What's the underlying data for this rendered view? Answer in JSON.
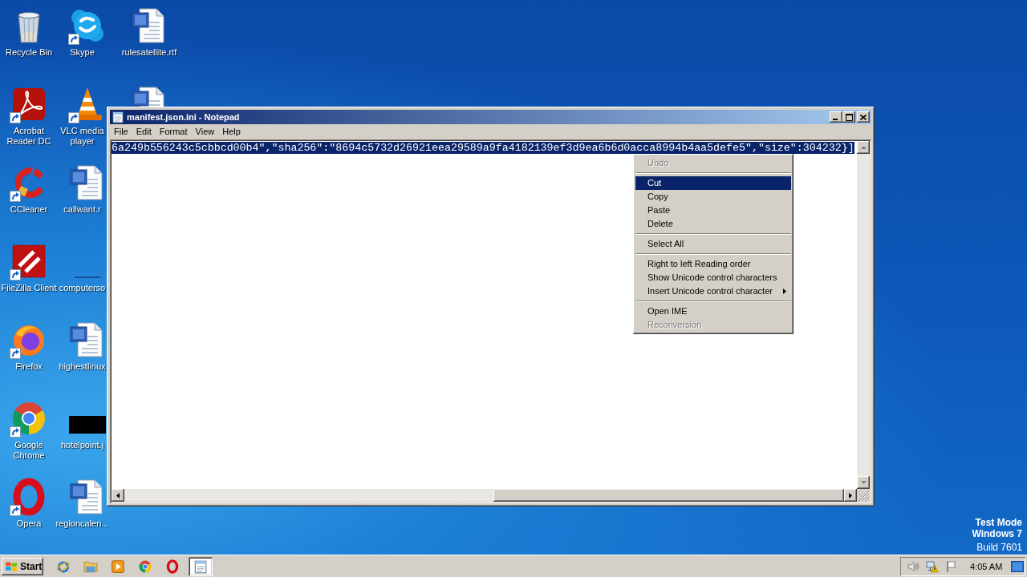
{
  "desktop": {
    "columns": [
      [
        {
          "kind": "recycle-bin",
          "label": "Recycle Bin",
          "shortcut": false
        },
        {
          "kind": "acrobat",
          "label": "Acrobat Reader DC",
          "shortcut": true
        },
        {
          "kind": "ccleaner",
          "label": "CCleaner",
          "shortcut": true
        },
        {
          "kind": "filezilla",
          "label": "FileZilla Client",
          "shortcut": true
        },
        {
          "kind": "firefox",
          "label": "Firefox",
          "shortcut": true
        },
        {
          "kind": "chrome",
          "label": "Google Chrome",
          "shortcut": true
        },
        {
          "kind": "opera",
          "label": "Opera",
          "shortcut": true
        }
      ],
      [
        {
          "kind": "skype",
          "label": "Skype",
          "shortcut": true
        },
        {
          "kind": "vlc",
          "label": "VLC media player",
          "shortcut": true
        },
        {
          "kind": "word-doc",
          "label": "callwant.r",
          "shortcut": false
        },
        {
          "kind": "blank",
          "label": "computerso",
          "shortcut": false
        },
        {
          "kind": "word-doc",
          "label": "highestlinux",
          "shortcut": false
        },
        {
          "kind": "image",
          "label": "hotelpoint.j",
          "shortcut": false
        },
        {
          "kind": "word-doc",
          "label": "regioncalen...",
          "shortcut": false
        }
      ],
      [
        {
          "kind": "word-doc",
          "label": "rulesatellite.rtf",
          "shortcut": false
        },
        {
          "kind": "word-doc",
          "shortcut": false,
          "partly_hidden": true
        }
      ]
    ]
  },
  "notepad": {
    "title": "manifest.json.ini - Notepad",
    "menu": [
      "File",
      "Edit",
      "Format",
      "View",
      "Help"
    ],
    "content": {
      "text": "6a249b556243c5cbbcd00b4\",\"sha256\":\"8694c5732d26921eea29589a9fa4182139ef3d9ea6b6d0acca8994b4aa5defe5\",\"size\":304232}]",
      "selected": true
    }
  },
  "context_menu": {
    "items": [
      {
        "kind": "item",
        "label": "Undo",
        "disabled": true,
        "selected": false,
        "submenu": false
      },
      {
        "kind": "separator"
      },
      {
        "kind": "item",
        "label": "Cut",
        "disabled": false,
        "selected": true,
        "submenu": false
      },
      {
        "kind": "item",
        "label": "Copy",
        "disabled": false,
        "selected": false,
        "submenu": false
      },
      {
        "kind": "item",
        "label": "Paste",
        "disabled": false,
        "selected": false,
        "submenu": false
      },
      {
        "kind": "item",
        "label": "Delete",
        "disabled": false,
        "selected": false,
        "submenu": false
      },
      {
        "kind": "separator"
      },
      {
        "kind": "item",
        "label": "Select All",
        "disabled": false,
        "selected": false,
        "submenu": false
      },
      {
        "kind": "separator"
      },
      {
        "kind": "item",
        "label": "Right to left Reading order",
        "disabled": false,
        "selected": false,
        "submenu": false
      },
      {
        "kind": "item",
        "label": "Show Unicode control characters",
        "disabled": false,
        "selected": false,
        "submenu": false
      },
      {
        "kind": "item",
        "label": "Insert Unicode control character",
        "disabled": false,
        "selected": false,
        "submenu": true
      },
      {
        "kind": "separator"
      },
      {
        "kind": "item",
        "label": "Open IME",
        "disabled": false,
        "selected": false,
        "submenu": false
      },
      {
        "kind": "item",
        "label": "Reconversion",
        "disabled": true,
        "selected": false,
        "submenu": false
      }
    ]
  },
  "notice": {
    "lines": [
      {
        "text": "Test Mode",
        "bold": true
      },
      {
        "text": "Windows 7",
        "bold": true
      },
      {
        "text": "Build 7601",
        "bold": false
      }
    ]
  },
  "taskbar": {
    "start": "Start",
    "quick_launch": [
      {
        "kind": "ie"
      },
      {
        "kind": "explorer"
      },
      {
        "kind": "media-player"
      },
      {
        "kind": "chrome"
      },
      {
        "kind": "opera"
      }
    ],
    "tasks": [
      {
        "kind": "notepad",
        "selected": true
      }
    ],
    "tray": [
      {
        "kind": "volume"
      },
      {
        "kind": "network-warning"
      },
      {
        "kind": "flag"
      }
    ],
    "clock": "4:05 AM"
  }
}
